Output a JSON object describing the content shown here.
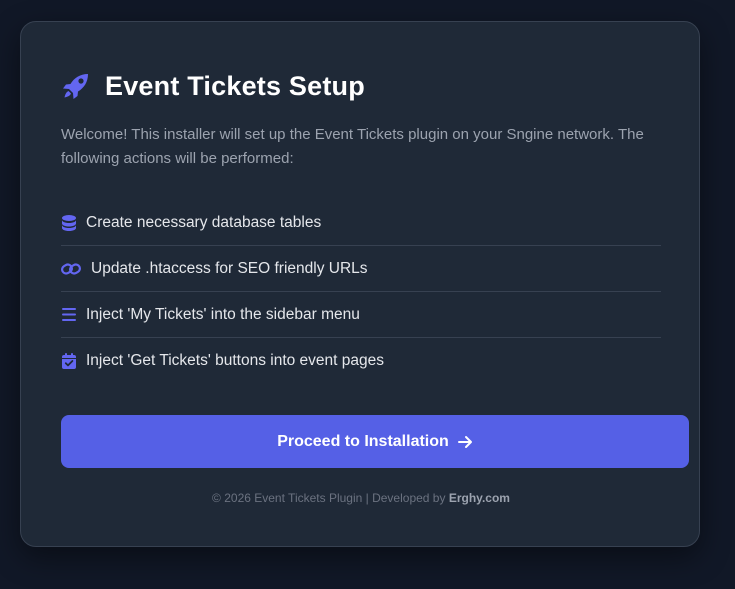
{
  "header": {
    "icon": "rocket-icon",
    "title": "Event Tickets Setup"
  },
  "intro": "Welcome! This installer will set up the Event Tickets plugin on your Sngine network. The following actions will be performed:",
  "actions": [
    {
      "icon": "database-icon",
      "label": "Create necessary database tables"
    },
    {
      "icon": "link-icon",
      "label": "Update .htaccess for SEO friendly URLs"
    },
    {
      "icon": "bars-icon",
      "label": "Inject 'My Tickets' into the sidebar menu"
    },
    {
      "icon": "calendar-check-icon",
      "label": "Inject 'Get Tickets' buttons into event pages"
    }
  ],
  "button": {
    "label": "Proceed to Installation",
    "icon": "arrow-right-icon"
  },
  "footer": {
    "text": "© 2026 Event Tickets Plugin | Developed by",
    "brand": "Erghy.com"
  },
  "colors": {
    "background": "#111827",
    "card": "#1f2937",
    "accent": "#5560e6",
    "icon": "#6366f1"
  }
}
